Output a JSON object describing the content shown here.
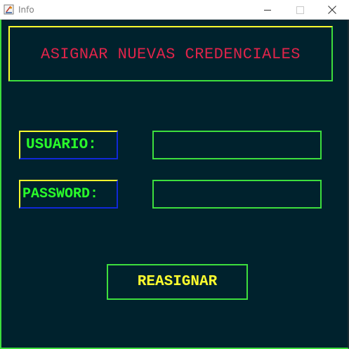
{
  "window": {
    "title": "Info",
    "icons": {
      "app": "java-app-icon",
      "minimize": "minimize-icon",
      "maximize": "maximize-icon",
      "close": "close-icon"
    }
  },
  "header": {
    "title": "ASIGNAR NUEVAS CREDENCIALES"
  },
  "form": {
    "user_label": "USUARIO:",
    "user_value": "",
    "password_label": "PASSWORD:",
    "password_value": "",
    "submit_label": "REASIGNAR"
  },
  "colors": {
    "background": "#00222d",
    "border_green": "#3dde3d",
    "border_yellow": "#ffff2e",
    "border_blue": "#1028d8",
    "title_red": "#e0244a",
    "label_green": "#2aff2a",
    "button_text_yellow": "#ffff2e"
  }
}
